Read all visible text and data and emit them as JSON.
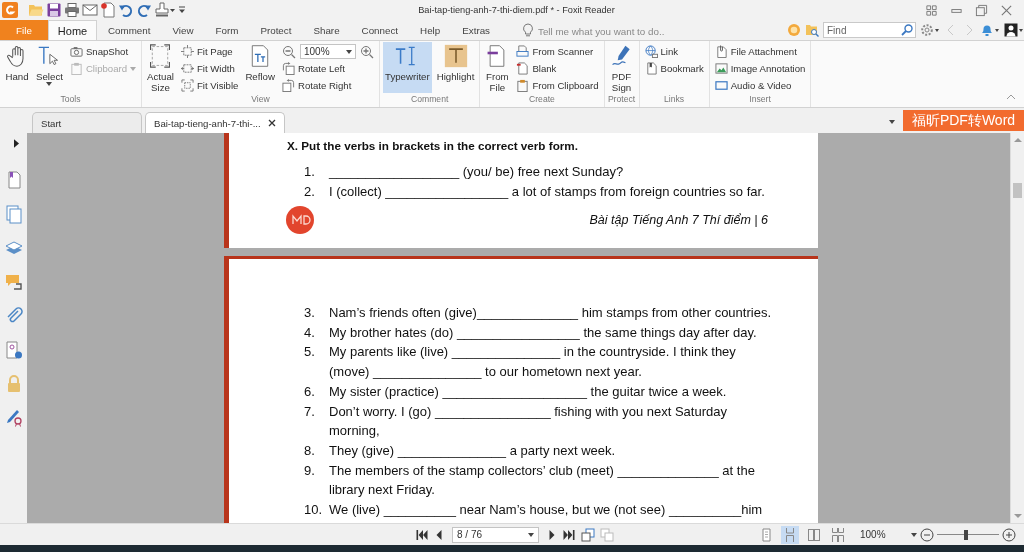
{
  "title_bar": {
    "title": "Bai-tap-tieng-anh-7-thi-diem.pdf * - Foxit Reader"
  },
  "ribbon_tabs": [
    {
      "label": "File",
      "kind": "file",
      "selected": false
    },
    {
      "label": "Home",
      "kind": "tab",
      "selected": true
    },
    {
      "label": "Comment",
      "kind": "tab",
      "selected": false
    },
    {
      "label": "View",
      "kind": "tab",
      "selected": false
    },
    {
      "label": "Form",
      "kind": "tab",
      "selected": false
    },
    {
      "label": "Protect",
      "kind": "tab",
      "selected": false
    },
    {
      "label": "Share",
      "kind": "tab",
      "selected": false
    },
    {
      "label": "Connect",
      "kind": "tab",
      "selected": false
    },
    {
      "label": "Help",
      "kind": "tab",
      "selected": false
    },
    {
      "label": "Extras",
      "kind": "tab",
      "selected": false
    }
  ],
  "tell_me": {
    "placeholder": "Tell me what you want to do.."
  },
  "find_field": {
    "placeholder": "Find"
  },
  "nav_arrows": [
    {
      "disabled": true
    },
    {
      "disabled": true
    }
  ],
  "ribbon_groups": [
    {
      "label": "Tools",
      "items": [
        {
          "kind": "large",
          "label": "Hand",
          "selected": false
        },
        {
          "kind": "large",
          "label": "Select",
          "selected": false,
          "dropdown": true
        },
        {
          "kind": "column",
          "items": [
            {
              "label": "SnapShot",
              "disabled": false
            },
            {
              "label": "Clipboard",
              "disabled": true,
              "dropdown": true
            }
          ]
        }
      ]
    },
    {
      "label": "View",
      "items": [
        {
          "kind": "large",
          "label": "Actual Size",
          "selected": false
        },
        {
          "kind": "column",
          "items": [
            {
              "label": "Fit Page",
              "disabled": false
            },
            {
              "label": "Fit Width",
              "disabled": false
            },
            {
              "label": "Fit Visible",
              "disabled": false
            }
          ]
        },
        {
          "kind": "large",
          "label": "Reflow",
          "selected": false
        },
        {
          "kind": "column",
          "items": [
            {
              "kind": "zoom",
              "value": "100%"
            },
            {
              "kind": "button",
              "label": "Rotate Left",
              "disabled": false
            },
            {
              "kind": "button",
              "label": "Rotate Right",
              "disabled": false
            }
          ]
        }
      ]
    },
    {
      "label": "Comment",
      "items": [
        {
          "kind": "large",
          "label": "Typewriter",
          "selected": true
        },
        {
          "kind": "large",
          "label": "Highlight",
          "selected": false
        }
      ]
    },
    {
      "label": "Create",
      "items": [
        {
          "kind": "large",
          "label": "From File",
          "selected": false
        },
        {
          "kind": "column",
          "items": [
            {
              "label": "From Scanner",
              "disabled": false
            },
            {
              "label": "Blank",
              "disabled": false
            },
            {
              "label": "From Clipboard",
              "disabled": false
            }
          ]
        }
      ]
    },
    {
      "label": "Protect",
      "items": [
        {
          "kind": "large",
          "label": "PDF Sign",
          "selected": false
        }
      ]
    },
    {
      "label": "Links",
      "items": [
        {
          "kind": "column",
          "items": [
            {
              "label": "Link",
              "disabled": false
            },
            {
              "label": "Bookmark",
              "disabled": false
            }
          ]
        }
      ]
    },
    {
      "label": "Insert",
      "items": [
        {
          "kind": "column",
          "items": [
            {
              "label": "File Attachment",
              "disabled": false
            },
            {
              "label": "Image Annotation",
              "disabled": false
            },
            {
              "label": "Audio & Video",
              "disabled": false
            }
          ]
        }
      ]
    }
  ],
  "document_tabs": [
    {
      "label": "Start",
      "selected": false
    },
    {
      "label": "Bai-tap-tieng-anh-7-thi-...",
      "selected": true
    }
  ],
  "convert_button": {
    "label": "福昕PDF转Word"
  },
  "document": {
    "page_top": {
      "heading": "X. Put the verbs in brackets in the correct verb form.",
      "items": [
        {
          "number": "1.",
          "lines": [
            "__________________ (you/ be) free next Sunday?"
          ]
        },
        {
          "number": "2.",
          "lines": [
            "I (collect) _________________ a lot of stamps from foreign countries so far."
          ]
        }
      ],
      "footer": "Bài tập Tiếng Anh 7 Thí điểm | 6"
    },
    "page_bottom": {
      "items": [
        {
          "number": "3.",
          "lines": [
            "Nam’s friends often (give)______________ him stamps from other countries."
          ]
        },
        {
          "number": "4.",
          "lines": [
            "My brother hates (do) _________________ the same things day after day."
          ]
        },
        {
          "number": "5.",
          "lines": [
            "My parents like (live) _______________ in the countryside. I think they",
            "(move) _______________ to our hometown next year."
          ]
        },
        {
          "number": "6.",
          "lines": [
            "My sister (practice) ____________________ the guitar twice a week."
          ]
        },
        {
          "number": "7.",
          "lines": [
            "Don’t worry. I (go) ________________ fishing with you next Saturday",
            "morning,"
          ]
        },
        {
          "number": "8.",
          "lines": [
            "They (give) _______________ a party next week."
          ]
        },
        {
          "number": "9.",
          "lines": [
            "The members of the stamp collectors’ club (meet) ______________ at the",
            "library next Friday."
          ]
        },
        {
          "number": "10.",
          "lines": [
            "We (live) __________ near Nam’s house, but we (not see) __________him"
          ]
        }
      ]
    }
  },
  "status_bar": {
    "page_field": "8 / 76",
    "view_history": [
      {
        "disabled": false
      },
      {
        "disabled": true
      }
    ],
    "view_modes": [
      {
        "selected": false
      },
      {
        "selected": true
      },
      {
        "selected": false
      },
      {
        "selected": false
      }
    ],
    "zoom": "100%",
    "zoom_slider": {
      "level": 0.47
    }
  }
}
